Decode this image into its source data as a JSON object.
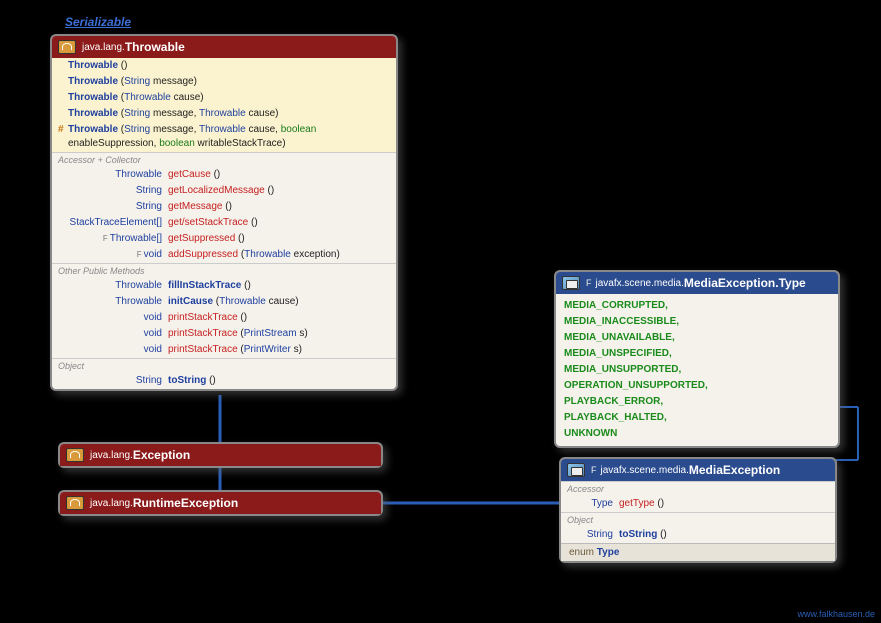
{
  "interface": "Serializable",
  "throwable": {
    "pkg": "java.lang.",
    "name": "Throwable",
    "ctors": [
      {
        "mod": "",
        "name": "Throwable",
        "params": []
      },
      {
        "mod": "",
        "name": "Throwable",
        "params": [
          {
            "t": "String",
            "n": "message"
          }
        ]
      },
      {
        "mod": "",
        "name": "Throwable",
        "params": [
          {
            "t": "Throwable",
            "n": "cause"
          }
        ]
      },
      {
        "mod": "",
        "name": "Throwable",
        "params": [
          {
            "t": "String",
            "n": "message"
          },
          {
            "t": "Throwable",
            "n": "cause"
          }
        ]
      },
      {
        "mod": "#",
        "name": "Throwable",
        "params": [
          {
            "t": "String",
            "n": "message"
          },
          {
            "t": "Throwable",
            "n": "cause"
          },
          {
            "t": "boolean",
            "n": "enableSuppression",
            "g": true
          },
          {
            "t": "boolean",
            "n": "writableStackTrace",
            "g": true
          }
        ]
      }
    ],
    "sect_acc": "Accessor + Collector",
    "acc": [
      {
        "ret": "Throwable",
        "name": "getCause",
        "red": true,
        "params": []
      },
      {
        "ret": "String",
        "name": "getLocalizedMessage",
        "red": true,
        "params": []
      },
      {
        "ret": "String",
        "name": "getMessage",
        "red": true,
        "params": []
      },
      {
        "ret": "StackTraceElement[]",
        "name": "get/setStackTrace",
        "red": true,
        "params": []
      },
      {
        "flag": "F",
        "ret": "Throwable[]",
        "name": "getSuppressed",
        "red": true,
        "params": []
      },
      {
        "flag": "F",
        "ret": "void",
        "name": "addSuppressed",
        "red": true,
        "params": [
          {
            "t": "Throwable",
            "n": "exception"
          }
        ]
      }
    ],
    "sect_other": "Other Public Methods",
    "other": [
      {
        "ret": "Throwable",
        "name": "fillInStackTrace",
        "params": []
      },
      {
        "ret": "Throwable",
        "name": "initCause",
        "params": [
          {
            "t": "Throwable",
            "n": "cause"
          }
        ]
      },
      {
        "ret": "void",
        "name": "printStackTrace",
        "red": true,
        "params": []
      },
      {
        "ret": "void",
        "name": "printStackTrace",
        "red": true,
        "params": [
          {
            "t": "PrintStream",
            "n": "s"
          }
        ]
      },
      {
        "ret": "void",
        "name": "printStackTrace",
        "red": true,
        "params": [
          {
            "t": "PrintWriter",
            "n": "s"
          }
        ]
      }
    ],
    "sect_obj": "Object",
    "obj": [
      {
        "ret": "String",
        "name": "toString",
        "params": []
      }
    ]
  },
  "exception": {
    "pkg": "java.lang.",
    "name": "Exception"
  },
  "runtime": {
    "pkg": "java.lang.",
    "name": "RuntimeException"
  },
  "enumType": {
    "flag": "F",
    "pkg": "javafx.scene.media.",
    "name": "MediaException.Type",
    "values": [
      "MEDIA_CORRUPTED",
      "MEDIA_INACCESSIBLE",
      "MEDIA_UNAVAILABLE",
      "MEDIA_UNSPECIFIED",
      "MEDIA_UNSUPPORTED",
      "OPERATION_UNSUPPORTED",
      "PLAYBACK_ERROR",
      "PLAYBACK_HALTED",
      "UNKNOWN"
    ]
  },
  "mediaEx": {
    "flag": "F",
    "pkg": "javafx.scene.media.",
    "name": "MediaException",
    "sect_acc": "Accessor",
    "acc": [
      {
        "ret": "Type",
        "name": "getType",
        "red": true,
        "params": []
      }
    ],
    "sect_obj": "Object",
    "obj": [
      {
        "ret": "String",
        "name": "toString",
        "params": []
      }
    ],
    "inner": {
      "kw": "enum",
      "name": "Type"
    }
  },
  "credit": "www.falkhausen.de"
}
